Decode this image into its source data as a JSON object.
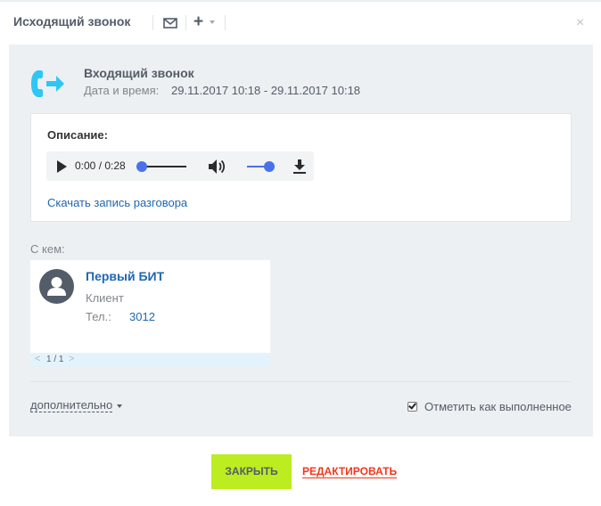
{
  "header": {
    "title": "Исходящий звонок",
    "icons": [
      "mail-icon",
      "plus-icon",
      "close-icon"
    ],
    "close_glyph": "×",
    "plus_glyph": "+"
  },
  "activity": {
    "icon": "phone-incoming-icon",
    "title": "Входящий звонок",
    "date_label": "Дата и время:",
    "date_value": "29.11.2017 10:18 - 29.11.2017 10:18"
  },
  "description": {
    "label": "Описание:",
    "player": {
      "time": "0:00 / 0:28",
      "progress": 0,
      "volume": 1.0,
      "icons": [
        "play-icon",
        "volume-icon",
        "download-icon"
      ]
    },
    "download_link": "Скачать запись разговора"
  },
  "communications": {
    "label": "С кем:",
    "contact": {
      "name": "Первый БИТ",
      "type": "Клиент",
      "phone_label": "Тел.:",
      "phone": "3012"
    },
    "pager": {
      "prev": "<",
      "count": "1 / 1",
      "next": ">"
    }
  },
  "footer": {
    "more_label": "дополнительно",
    "complete_label": "Отметить как выполненное",
    "complete_checked": true
  },
  "buttons": {
    "close": "ЗАКРЫТЬ",
    "edit": "РЕДАКТИРОВАТЬ"
  },
  "colors": {
    "accent_blue": "#2067b0",
    "close_green": "#bbed21",
    "edit_red": "#f1361b",
    "panel_bg": "#edf0f2",
    "icon_blue": "#2fc6f6",
    "slider_blue": "#4a72e8"
  }
}
